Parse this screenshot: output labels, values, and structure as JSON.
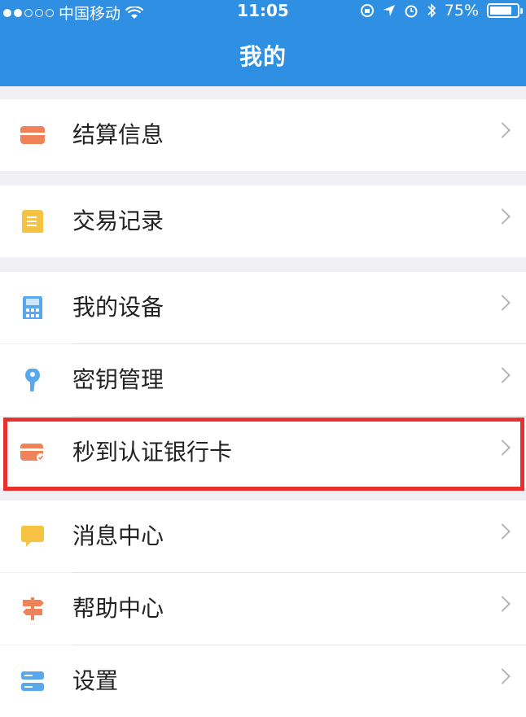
{
  "status_bar": {
    "carrier": "中国移动",
    "time": "11:05",
    "battery": "75%"
  },
  "nav": {
    "title": "我的"
  },
  "menu": [
    {
      "label": "结算信息",
      "icon": "settlement-card-icon"
    },
    {
      "label": "交易记录",
      "icon": "document-icon"
    },
    {
      "label": "我的设备",
      "icon": "calculator-device-icon"
    },
    {
      "label": "密钥管理",
      "icon": "key-icon"
    },
    {
      "label": "秒到认证银行卡",
      "icon": "verified-bank-card-icon"
    },
    {
      "label": "消息中心",
      "icon": "message-bubble-icon"
    },
    {
      "label": "帮助中心",
      "icon": "signpost-icon"
    },
    {
      "label": "设置",
      "icon": "settings-bars-icon"
    }
  ],
  "colors": {
    "header": "#2f8fe3",
    "highlight": "#e8312f",
    "orange": "#f0825a",
    "yellow": "#f5c242",
    "blue": "#5aa8ec"
  }
}
